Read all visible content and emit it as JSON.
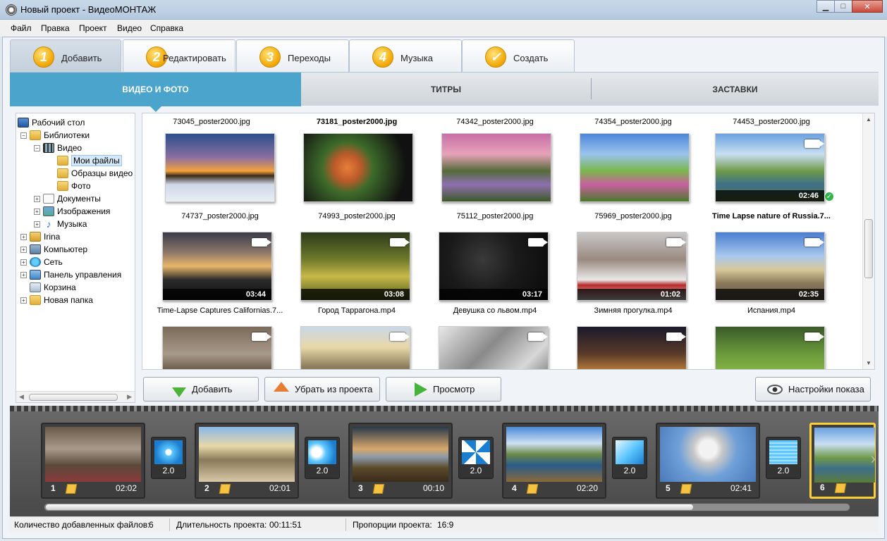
{
  "window": {
    "title": "Новый проект - ВидеоМОНТАЖ"
  },
  "menu": [
    "Файл",
    "Правка",
    "Проект",
    "Видео",
    "Справка"
  ],
  "steps": [
    {
      "num": "1",
      "label": "Добавить"
    },
    {
      "num": "2",
      "label": "Редактировать"
    },
    {
      "num": "3",
      "label": "Переходы"
    },
    {
      "num": "4",
      "label": "Музыка"
    },
    {
      "num": "✓",
      "label": "Создать"
    }
  ],
  "subtabs": [
    "ВИДЕО И ФОТО",
    "ТИТРЫ",
    "ЗАСТАВКИ"
  ],
  "tree": [
    {
      "label": "Рабочий стол",
      "icon": "desktop-icon"
    },
    {
      "label": "Библиотеки",
      "icon": "folder-icon"
    },
    {
      "label": "Видео",
      "icon": "film-icon"
    },
    {
      "label": "Мои файлы",
      "icon": "folder-icon"
    },
    {
      "label": "Образцы видео",
      "icon": "folder-icon"
    },
    {
      "label": "Фото",
      "icon": "folder-icon"
    },
    {
      "label": "Документы",
      "icon": "document-icon"
    },
    {
      "label": "Изображения",
      "icon": "image-icon"
    },
    {
      "label": "Музыка",
      "icon": "music-icon"
    },
    {
      "label": "Irina",
      "icon": "user-icon"
    },
    {
      "label": "Компьютер",
      "icon": "computer-icon"
    },
    {
      "label": "Сеть",
      "icon": "network-icon"
    },
    {
      "label": "Панель управления",
      "icon": "control-panel-icon"
    },
    {
      "label": "Корзина",
      "icon": "recycle-bin-icon"
    },
    {
      "label": "Новая папка",
      "icon": "folder-icon"
    }
  ],
  "grid": {
    "row0_labels": [
      "73045_poster2000.jpg",
      "73181_poster2000.jpg",
      "74342_poster2000.jpg",
      "74354_poster2000.jpg",
      "74453_poster2000.jpg"
    ],
    "row1": [
      {
        "label": "74737_poster2000.jpg",
        "duration": ""
      },
      {
        "label": "74993_poster2000.jpg",
        "duration": ""
      },
      {
        "label": "75112_poster2000.jpg",
        "duration": ""
      },
      {
        "label": "75969_poster2000.jpg",
        "duration": ""
      },
      {
        "label": "Time Lapse nature of Russia.7...",
        "duration": "02:46"
      }
    ],
    "row2": [
      {
        "label": "Time-Lapse Captures Californias.7...",
        "duration": "03:44"
      },
      {
        "label": "Город Таррагона.mp4",
        "duration": "03:08"
      },
      {
        "label": "Девушка со львом.mp4",
        "duration": "03:17"
      },
      {
        "label": "Зимняя прогулка.mp4",
        "duration": "01:02"
      },
      {
        "label": "Испания.mp4",
        "duration": "02:35"
      }
    ]
  },
  "buttons": {
    "add": "Добавить",
    "remove": "Убрать из проекта",
    "preview": "Просмотр",
    "settings": "Настройки показа"
  },
  "timeline": {
    "slides": [
      {
        "num": "1",
        "time": "02:02"
      },
      {
        "num": "2",
        "time": "02:01"
      },
      {
        "num": "3",
        "time": "00:10"
      },
      {
        "num": "4",
        "time": "02:20"
      },
      {
        "num": "5",
        "time": "02:41"
      },
      {
        "num": "6",
        "time": ""
      }
    ],
    "transitions": [
      "2.0",
      "2.0",
      "2.0",
      "2.0",
      "2.0"
    ]
  },
  "status": {
    "files_label": "Количество добавленных файлов:",
    "files_value": "6",
    "duration_label": "Длительность проекта:",
    "duration_value": "00:11:51",
    "ratio_label": "Пропорции проекта:",
    "ratio_value": "16:9"
  }
}
